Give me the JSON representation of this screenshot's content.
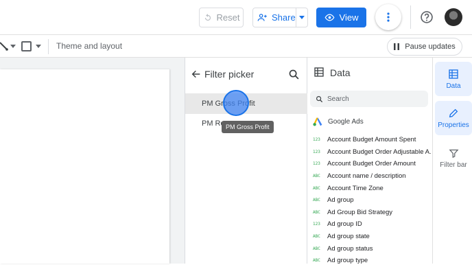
{
  "header": {
    "reset_label": "Reset",
    "share_label": "Share",
    "view_label": "View"
  },
  "toolbar": {
    "theme_label": "Theme and layout",
    "pause_label": "Pause updates"
  },
  "filter_picker": {
    "title": "Filter picker",
    "items": [
      "PM Gross Profit",
      "PM Rev"
    ],
    "tooltip": "PM Gross Profit"
  },
  "data_panel": {
    "title": "Data",
    "search_placeholder": "Search",
    "source_name": "Google Ads",
    "fields": [
      {
        "type": "123",
        "name": "Account Budget Amount Spent"
      },
      {
        "type": "123",
        "name": "Account Budget Order Adjustable A..."
      },
      {
        "type": "123",
        "name": "Account Budget Order Amount"
      },
      {
        "type": "ABC",
        "name": "Account name / description"
      },
      {
        "type": "ABC",
        "name": "Account Time Zone"
      },
      {
        "type": "ABC",
        "name": "Ad group"
      },
      {
        "type": "ABC",
        "name": "Ad Group Bid Strategy"
      },
      {
        "type": "123",
        "name": "Ad group ID"
      },
      {
        "type": "ABC",
        "name": "Ad group state"
      },
      {
        "type": "ABC",
        "name": "Ad group status"
      },
      {
        "type": "ABC",
        "name": "Ad group type"
      }
    ]
  },
  "side_tabs": {
    "data": "Data",
    "properties": "Properties",
    "filter_bar": "Filter bar"
  },
  "colors": {
    "accent": "#1a73e8",
    "type_green": "#34a853"
  }
}
